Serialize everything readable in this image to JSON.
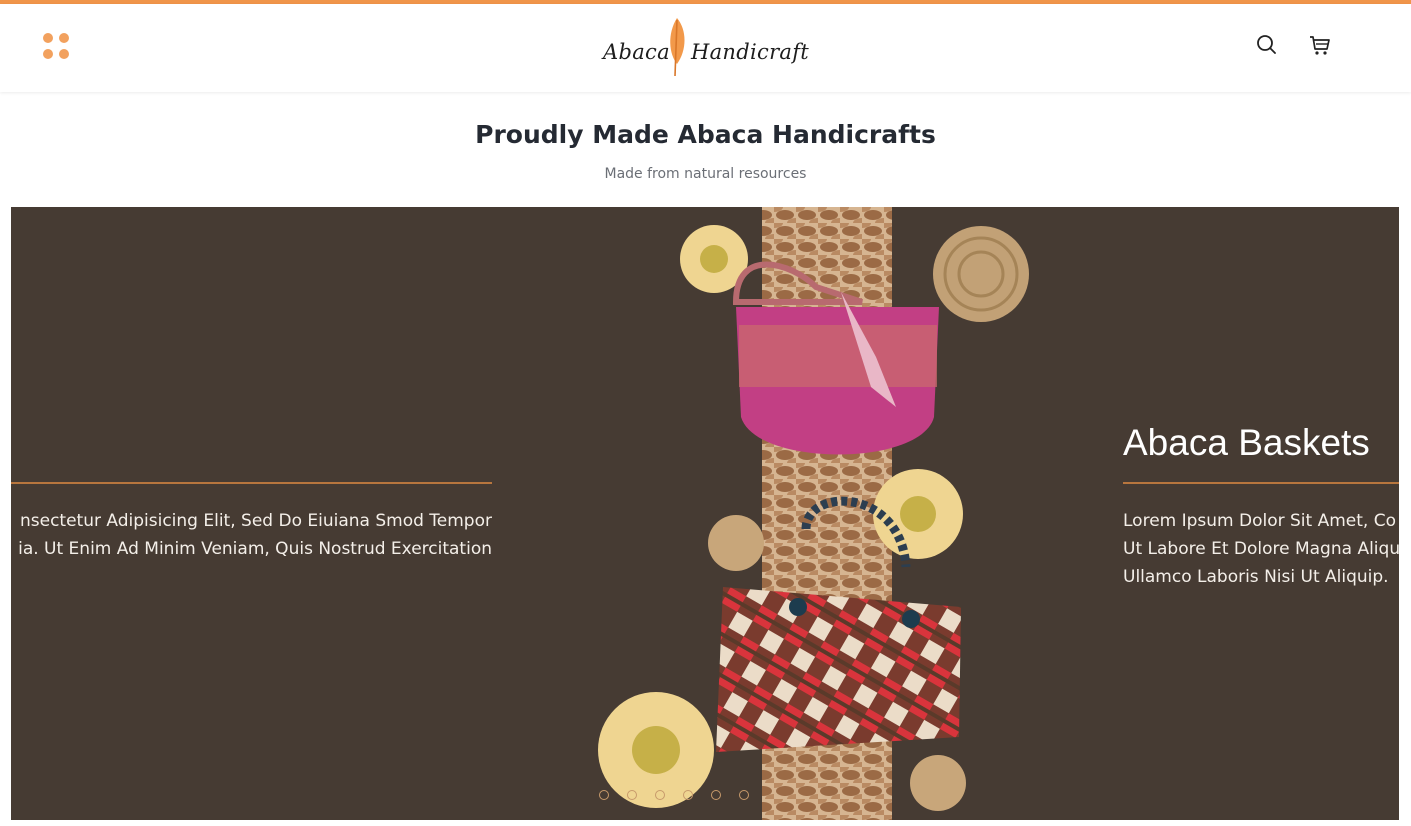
{
  "brand": {
    "name_left": "Abaca",
    "name_right": "Handicraft",
    "accent_color": "#f0954a",
    "background_color": "#463b33"
  },
  "header": {
    "menu_icon": "grid-dots-icon",
    "search_icon": "search-icon",
    "cart_icon": "cart-icon"
  },
  "hero": {
    "headline": "Proudly Made Abaca Handicrafts",
    "subheadline": "Made from natural resources"
  },
  "slider": {
    "left_slide_text_line1": "nsectetur Adipisicing Elit, Sed Do Eiuiana Smod Tempor",
    "left_slide_text_line2": "ia. Ut Enim Ad Minim Veniam, Quis Nostrud Exercitation",
    "right_slide_title": "Abaca Baskets",
    "right_slide_text_line1": "Lorem Ipsum Dolor Sit Amet, Co",
    "right_slide_text_line2": "Ut Labore Et Dolore Magna Aliqu",
    "right_slide_text_line3": "Ullamco Laboris Nisi Ut Aliquip.",
    "slide_count": 6
  }
}
